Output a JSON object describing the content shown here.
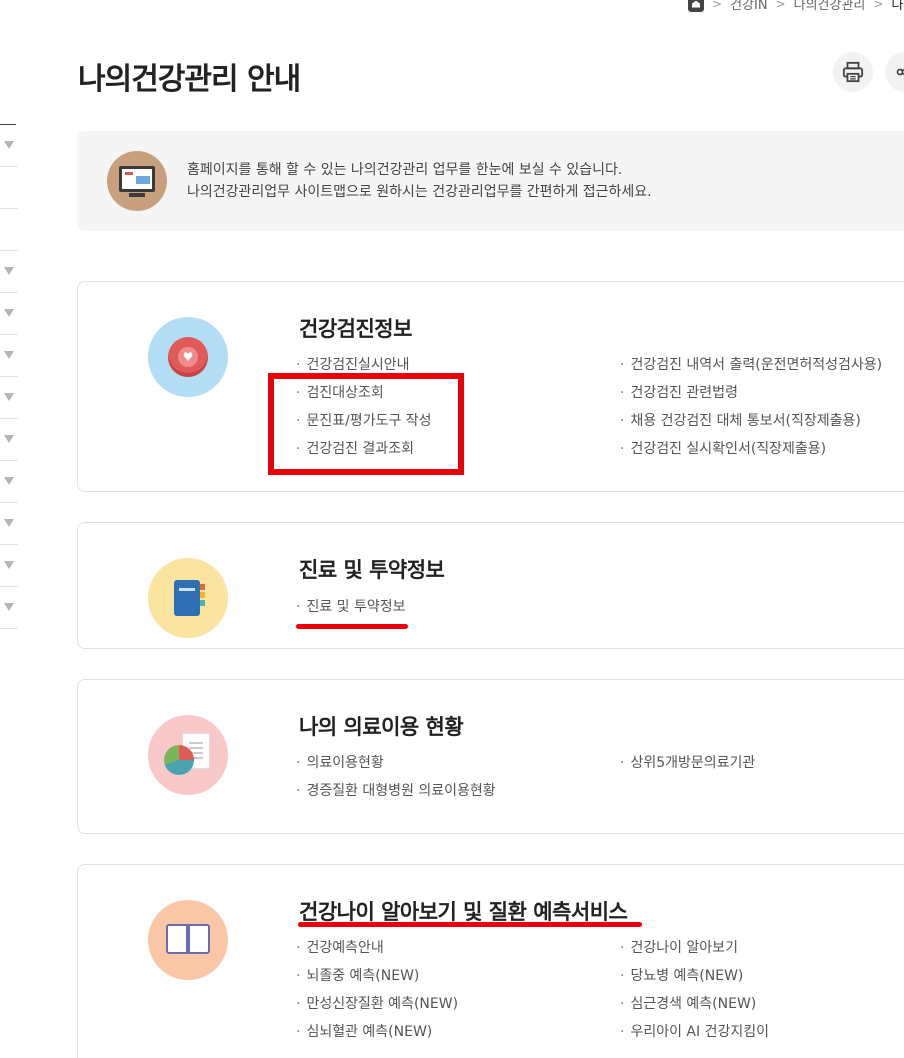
{
  "breadcrumb": {
    "items": [
      "건강IN",
      "나의건강관리",
      "나의"
    ]
  },
  "page": {
    "title": "나의건강관리 안내"
  },
  "actions": {
    "print_icon": "print-icon",
    "share_icon": "share-icon"
  },
  "info": {
    "line1": "홈페이지를 통해 할 수 있는 나의건강관리 업무를 한눈에 보실 수 있습니다.",
    "line2": "나의건강관리업무 사이트맵으로 원하시는 건강관리업무를 간편하게 접근하세요."
  },
  "sections": [
    {
      "title": "건강검진정보",
      "icon_bg": "#b3dcf5",
      "col1": [
        "건강검진실시안내",
        "검진대상조회",
        "문진표/평가도구 작성",
        "건강검진 결과조회"
      ],
      "col2": [
        "건강검진 내역서 출력(운전면허적성검사용)",
        "건강검진 관련법령",
        "채용 건강검진 대체 통보서(직장제출용)",
        "건강검진 실시확인서(직장제출용)"
      ]
    },
    {
      "title": "진료 및 투약정보",
      "icon_bg": "#fbe3a0",
      "col1": [
        "진료 및 투약정보"
      ],
      "col2": []
    },
    {
      "title": "나의 의료이용 현황",
      "icon_bg": "#f9c8c8",
      "col1": [
        "의료이용현황",
        "경증질환 대형병원 의료이용현황"
      ],
      "col2": [
        "상위5개방문의료기관"
      ]
    },
    {
      "title": "건강나이 알아보기 및 질환 예측서비스",
      "icon_bg": "#f9c7a6",
      "col1": [
        "건강예측안내",
        "뇌졸중 예측(NEW)",
        "만성신장질환 예측(NEW)",
        "심뇌혈관 예측(NEW)"
      ],
      "col2": [
        "건강나이 알아보기",
        "당뇨병 예측(NEW)",
        "심근경색 예측(NEW)",
        "우리아이 AI 건강지킴이"
      ]
    }
  ],
  "colors": {
    "annotation_red": "#e8000b",
    "text_dark": "#222222"
  }
}
